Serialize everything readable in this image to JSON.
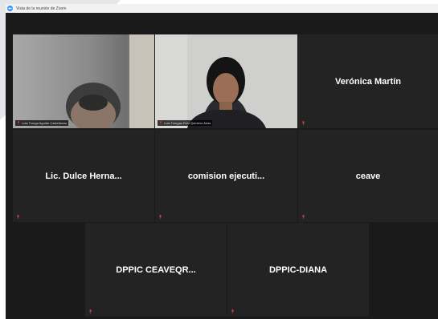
{
  "window": {
    "title": "Vista de la reunión de Zoom"
  },
  "colors": {
    "grid_background": "#1a1a1a",
    "tile_background": "#232323",
    "active_speaker_border": "#c9e26a",
    "muted_mic": "#e23a3a"
  },
  "icons": {
    "app": "zoom-logo-icon",
    "muted": "mic-muted-icon"
  },
  "participants": {
    "video1": {
      "label": "Lula Toruga Aguilar Castellanos"
    },
    "video2": {
      "label": "Lula Torugas Ruiz Quintero Arias"
    },
    "tile3": {
      "name": "Verónica Martín"
    },
    "tile4": {
      "name": "Lic. Dulce Herna..."
    },
    "tile5": {
      "name": "comision ejecuti..."
    },
    "tile6": {
      "name": "ceave"
    },
    "tile7": {
      "name": "DPPIC CEAVEQR..."
    },
    "tile8": {
      "name": "DPPIC-DIANA"
    }
  }
}
